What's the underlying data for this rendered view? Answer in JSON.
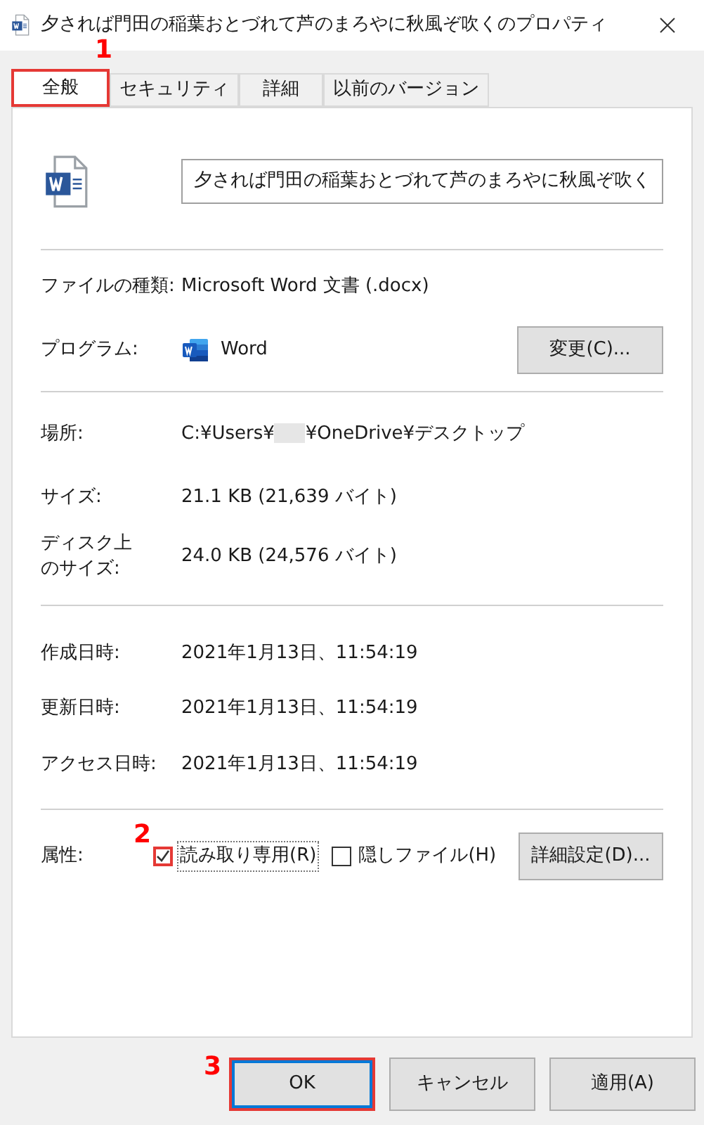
{
  "window": {
    "title": "夕されば門田の稲葉おとづれて芦のまろやに秋風ぞ吹くのプロパティ"
  },
  "tabs": [
    {
      "label": "全般",
      "selected": true,
      "highlighted": true,
      "marker": "1"
    },
    {
      "label": "セキュリティ",
      "selected": false,
      "highlighted": false
    },
    {
      "label": "詳細",
      "selected": false,
      "highlighted": false
    },
    {
      "label": "以前のバージョン",
      "selected": false,
      "highlighted": false
    }
  ],
  "file_name": {
    "value": "夕されば門田の稲葉おとづれて芦のまろやに秋風ぞ吹く"
  },
  "file_type": {
    "label": "ファイルの種類:",
    "value": "Microsoft Word 文書 (.docx)"
  },
  "program": {
    "label": "プログラム:",
    "value": "Word",
    "button": "変更(C)..."
  },
  "location": {
    "label": "場所:",
    "before_redaction": "C:¥Users¥",
    "after_redaction": "¥OneDrive¥デスクトップ"
  },
  "size": {
    "label": "サイズ:",
    "value": "21.1 KB (21,639 バイト)"
  },
  "disk_size": {
    "label_lines": [
      "ディスク上",
      "のサイズ:"
    ],
    "value": "24.0 KB (24,576 バイト)"
  },
  "dates": [
    {
      "label": "作成日時:",
      "value": "2021年1月13日、11:54:19"
    },
    {
      "label": "更新日時:",
      "value": "2021年1月13日、11:54:19"
    },
    {
      "label": "アクセス日時:",
      "value": "2021年1月13日、11:54:19"
    }
  ],
  "attributes": {
    "label": "属性:",
    "checkboxes": [
      {
        "label": "読み取り専用(R)",
        "checked": true,
        "highlighted": true,
        "marker": "2",
        "focused": true
      },
      {
        "label": "隠しファイル(H)",
        "checked": false,
        "highlighted": false,
        "focused": false
      }
    ],
    "button": "詳細設定(D)..."
  },
  "buttons": [
    {
      "label": "OK",
      "highlighted": true,
      "marker": "3",
      "default": true
    },
    {
      "label": "キャンセル",
      "highlighted": false,
      "default": false
    },
    {
      "label": "適用(A)",
      "highlighted": false,
      "default": false
    }
  ]
}
